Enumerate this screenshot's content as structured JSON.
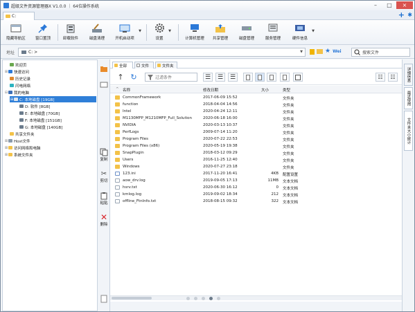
{
  "window": {
    "title": "超级文件资源管理器X V1.0.0 ｜ 64位操作系统"
  },
  "tabs": [
    {
      "label": "C:"
    }
  ],
  "toolbar": {
    "buttons": [
      {
        "label": "隐藏导航区"
      },
      {
        "label": "窗口置顶"
      },
      {
        "label": "卸载软件"
      },
      {
        "label": "磁盘清理"
      },
      {
        "label": "开机启动项"
      },
      {
        "label": "设置"
      },
      {
        "label": "计算机管理"
      },
      {
        "label": "共享管理"
      },
      {
        "label": "磁盘管理"
      },
      {
        "label": "服务管理"
      },
      {
        "label": "硬件信息"
      }
    ]
  },
  "address": {
    "label": "地址",
    "path": "C: >",
    "search_placeholder": "搜索文件"
  },
  "tree": [
    {
      "label": "欢迎页",
      "level": 1
    },
    {
      "label": "快速访问",
      "level": 0
    },
    {
      "label": "历史记录",
      "level": 1
    },
    {
      "label": "闪电网络",
      "level": 1
    },
    {
      "label": "我的电脑",
      "level": 0
    },
    {
      "label": "C: 本地磁盘 [19GB]",
      "level": 1,
      "selected": true
    },
    {
      "label": "D: 软件 [8GB]",
      "level": 2
    },
    {
      "label": "E: 本地磁盘 [70GB]",
      "level": 2
    },
    {
      "label": "F: 本地磁盘 [151GB]",
      "level": 2
    },
    {
      "label": "G: 本地磁盘 [140GB]",
      "level": 2
    },
    {
      "label": "共享文件夹",
      "level": 0
    },
    {
      "label": "Host文件",
      "level": 0
    },
    {
      "label": "访问网络和电脑",
      "level": 0
    },
    {
      "label": "系统文件夹",
      "level": 0
    }
  ],
  "side_actions": [
    {
      "label": "复制"
    },
    {
      "label": "剪切"
    },
    {
      "label": "粘贴"
    },
    {
      "label": "删除"
    }
  ],
  "filter_tabs": [
    {
      "label": "全部",
      "active": true
    },
    {
      "label": "文件"
    },
    {
      "label": "文件夹"
    }
  ],
  "filter": {
    "placeholder": "过滤条件"
  },
  "columns": {
    "name": "名称",
    "modified": "修改日期",
    "size": "大小",
    "type": "类型"
  },
  "files": [
    {
      "name": "CommonFramework",
      "modified": "2017-06-09 15:52",
      "size": "",
      "type": "文件夹",
      "kind": "folder"
    },
    {
      "name": "function",
      "modified": "2018-04-04 14:56",
      "size": "",
      "type": "文件夹",
      "kind": "folder"
    },
    {
      "name": "Intel",
      "modified": "2020-04-24 12:11",
      "size": "",
      "type": "文件夹",
      "kind": "folder"
    },
    {
      "name": "M1130MFP_M1210MFP_Full_Solution",
      "modified": "2020-06-18 16:00",
      "size": "",
      "type": "文件夹",
      "kind": "folder"
    },
    {
      "name": "NVIDIA",
      "modified": "2020-03-13 10:37",
      "size": "",
      "type": "文件夹",
      "kind": "folder"
    },
    {
      "name": "PerfLogs",
      "modified": "2009-07-14 11:20",
      "size": "",
      "type": "文件夹",
      "kind": "folder"
    },
    {
      "name": "Program Files",
      "modified": "2020-07-22 22:53",
      "size": "",
      "type": "文件夹",
      "kind": "folder"
    },
    {
      "name": "Program Files (x86)",
      "modified": "2020-05-19 19:38",
      "size": "",
      "type": "文件夹",
      "kind": "folder"
    },
    {
      "name": "SnapPlugin",
      "modified": "2018-03-12 09:29",
      "size": "",
      "type": "文件夹",
      "kind": "folder"
    },
    {
      "name": "Users",
      "modified": "2016-11-25 12:40",
      "size": "",
      "type": "文件夹",
      "kind": "folder"
    },
    {
      "name": "Windows",
      "modified": "2020-07-27 23:18",
      "size": "",
      "type": "文件夹",
      "kind": "folder"
    },
    {
      "name": "123.ini",
      "modified": "2017-11-20 16:41",
      "size": "4KB",
      "type": "配置设置",
      "kind": "ini"
    },
    {
      "name": "aow_drv.log",
      "modified": "2019-09-05 17:13",
      "size": "11MB",
      "type": "文本文档",
      "kind": "file"
    },
    {
      "name": "hsrv.txt",
      "modified": "2020-06-30 16:12",
      "size": "0",
      "type": "文本文档",
      "kind": "file"
    },
    {
      "name": "kmlog.log",
      "modified": "2019-09-02 18:34",
      "size": "212",
      "type": "文本文档",
      "kind": "file"
    },
    {
      "name": "offline_FtnInfo.txt",
      "modified": "2018-08-15 09:32",
      "size": "322",
      "type": "文本文档",
      "kind": "file"
    }
  ],
  "right_tabs": [
    {
      "label": "详细信息"
    },
    {
      "label": "最近使用"
    },
    {
      "label": "文件夹大小统计"
    }
  ],
  "colors": {
    "accent": "#2f7fd8",
    "folder": "#f3c248",
    "delete": "#d9262c"
  }
}
